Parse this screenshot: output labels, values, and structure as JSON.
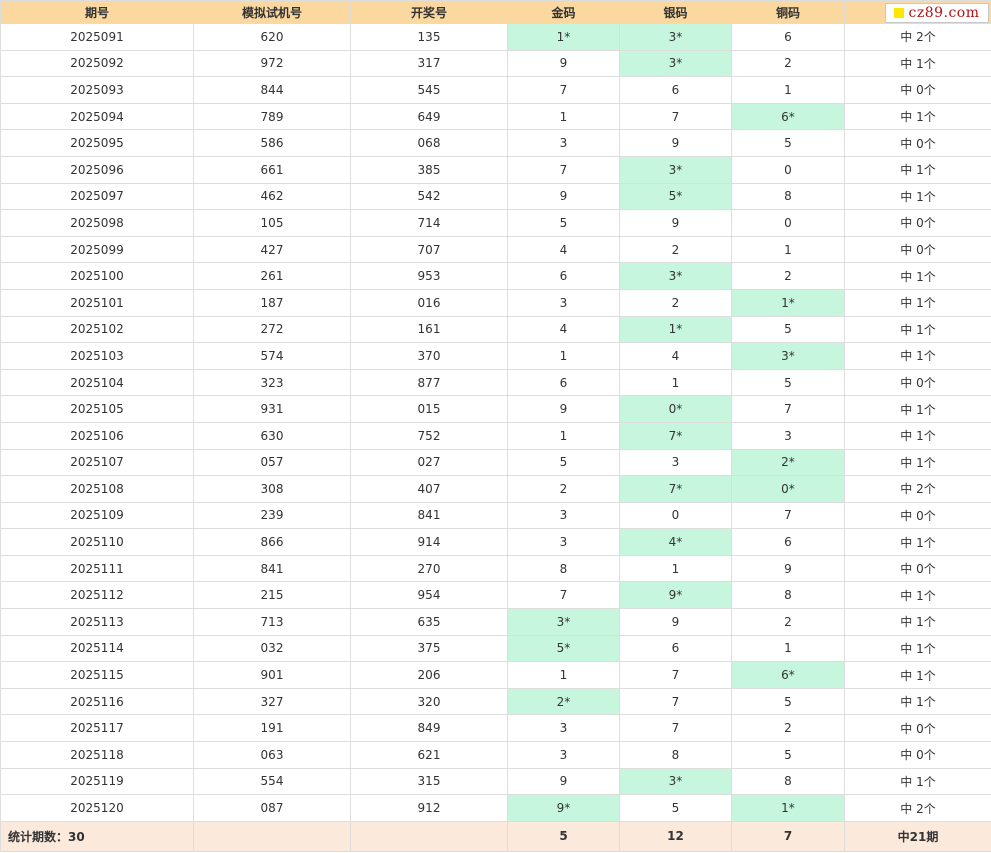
{
  "header": {
    "period": "期号",
    "sim_number": "模拟试机号",
    "draw_number": "开奖号",
    "gold": "金码",
    "silver": "银码",
    "bronze": "铜码",
    "logo_text": "cz89.com"
  },
  "colors": {
    "header_bg": "#fbd89f",
    "hit_bg": "#c6f7de",
    "footer_bg": "#fbe9dc",
    "logo_square": "#ffe600",
    "logo_text": "#b31010"
  },
  "rows": [
    {
      "period": "2025091",
      "sim": "620",
      "draw": "135",
      "gold": {
        "v": "1*",
        "hit": true
      },
      "silver": {
        "v": "3*",
        "hit": true
      },
      "bronze": {
        "v": "6",
        "hit": false
      },
      "result": "中 2个"
    },
    {
      "period": "2025092",
      "sim": "972",
      "draw": "317",
      "gold": {
        "v": "9",
        "hit": false
      },
      "silver": {
        "v": "3*",
        "hit": true
      },
      "bronze": {
        "v": "2",
        "hit": false
      },
      "result": "中 1个"
    },
    {
      "period": "2025093",
      "sim": "844",
      "draw": "545",
      "gold": {
        "v": "7",
        "hit": false
      },
      "silver": {
        "v": "6",
        "hit": false
      },
      "bronze": {
        "v": "1",
        "hit": false
      },
      "result": "中 0个"
    },
    {
      "period": "2025094",
      "sim": "789",
      "draw": "649",
      "gold": {
        "v": "1",
        "hit": false
      },
      "silver": {
        "v": "7",
        "hit": false
      },
      "bronze": {
        "v": "6*",
        "hit": true
      },
      "result": "中 1个"
    },
    {
      "period": "2025095",
      "sim": "586",
      "draw": "068",
      "gold": {
        "v": "3",
        "hit": false
      },
      "silver": {
        "v": "9",
        "hit": false
      },
      "bronze": {
        "v": "5",
        "hit": false
      },
      "result": "中 0个"
    },
    {
      "period": "2025096",
      "sim": "661",
      "draw": "385",
      "gold": {
        "v": "7",
        "hit": false
      },
      "silver": {
        "v": "3*",
        "hit": true
      },
      "bronze": {
        "v": "0",
        "hit": false
      },
      "result": "中 1个"
    },
    {
      "period": "2025097",
      "sim": "462",
      "draw": "542",
      "gold": {
        "v": "9",
        "hit": false
      },
      "silver": {
        "v": "5*",
        "hit": true
      },
      "bronze": {
        "v": "8",
        "hit": false
      },
      "result": "中 1个"
    },
    {
      "period": "2025098",
      "sim": "105",
      "draw": "714",
      "gold": {
        "v": "5",
        "hit": false
      },
      "silver": {
        "v": "9",
        "hit": false
      },
      "bronze": {
        "v": "0",
        "hit": false
      },
      "result": "中 0个"
    },
    {
      "period": "2025099",
      "sim": "427",
      "draw": "707",
      "gold": {
        "v": "4",
        "hit": false
      },
      "silver": {
        "v": "2",
        "hit": false
      },
      "bronze": {
        "v": "1",
        "hit": false
      },
      "result": "中 0个"
    },
    {
      "period": "2025100",
      "sim": "261",
      "draw": "953",
      "gold": {
        "v": "6",
        "hit": false
      },
      "silver": {
        "v": "3*",
        "hit": true
      },
      "bronze": {
        "v": "2",
        "hit": false
      },
      "result": "中 1个"
    },
    {
      "period": "2025101",
      "sim": "187",
      "draw": "016",
      "gold": {
        "v": "3",
        "hit": false
      },
      "silver": {
        "v": "2",
        "hit": false
      },
      "bronze": {
        "v": "1*",
        "hit": true
      },
      "result": "中 1个"
    },
    {
      "period": "2025102",
      "sim": "272",
      "draw": "161",
      "gold": {
        "v": "4",
        "hit": false
      },
      "silver": {
        "v": "1*",
        "hit": true
      },
      "bronze": {
        "v": "5",
        "hit": false
      },
      "result": "中 1个"
    },
    {
      "period": "2025103",
      "sim": "574",
      "draw": "370",
      "gold": {
        "v": "1",
        "hit": false
      },
      "silver": {
        "v": "4",
        "hit": false
      },
      "bronze": {
        "v": "3*",
        "hit": true
      },
      "result": "中 1个"
    },
    {
      "period": "2025104",
      "sim": "323",
      "draw": "877",
      "gold": {
        "v": "6",
        "hit": false
      },
      "silver": {
        "v": "1",
        "hit": false
      },
      "bronze": {
        "v": "5",
        "hit": false
      },
      "result": "中 0个"
    },
    {
      "period": "2025105",
      "sim": "931",
      "draw": "015",
      "gold": {
        "v": "9",
        "hit": false
      },
      "silver": {
        "v": "0*",
        "hit": true
      },
      "bronze": {
        "v": "7",
        "hit": false
      },
      "result": "中 1个"
    },
    {
      "period": "2025106",
      "sim": "630",
      "draw": "752",
      "gold": {
        "v": "1",
        "hit": false
      },
      "silver": {
        "v": "7*",
        "hit": true
      },
      "bronze": {
        "v": "3",
        "hit": false
      },
      "result": "中 1个"
    },
    {
      "period": "2025107",
      "sim": "057",
      "draw": "027",
      "gold": {
        "v": "5",
        "hit": false
      },
      "silver": {
        "v": "3",
        "hit": false
      },
      "bronze": {
        "v": "2*",
        "hit": true
      },
      "result": "中 1个"
    },
    {
      "period": "2025108",
      "sim": "308",
      "draw": "407",
      "gold": {
        "v": "2",
        "hit": false
      },
      "silver": {
        "v": "7*",
        "hit": true
      },
      "bronze": {
        "v": "0*",
        "hit": true
      },
      "result": "中 2个"
    },
    {
      "period": "2025109",
      "sim": "239",
      "draw": "841",
      "gold": {
        "v": "3",
        "hit": false
      },
      "silver": {
        "v": "0",
        "hit": false
      },
      "bronze": {
        "v": "7",
        "hit": false
      },
      "result": "中 0个"
    },
    {
      "period": "2025110",
      "sim": "866",
      "draw": "914",
      "gold": {
        "v": "3",
        "hit": false
      },
      "silver": {
        "v": "4*",
        "hit": true
      },
      "bronze": {
        "v": "6",
        "hit": false
      },
      "result": "中 1个"
    },
    {
      "period": "2025111",
      "sim": "841",
      "draw": "270",
      "gold": {
        "v": "8",
        "hit": false
      },
      "silver": {
        "v": "1",
        "hit": false
      },
      "bronze": {
        "v": "9",
        "hit": false
      },
      "result": "中 0个"
    },
    {
      "period": "2025112",
      "sim": "215",
      "draw": "954",
      "gold": {
        "v": "7",
        "hit": false
      },
      "silver": {
        "v": "9*",
        "hit": true
      },
      "bronze": {
        "v": "8",
        "hit": false
      },
      "result": "中 1个"
    },
    {
      "period": "2025113",
      "sim": "713",
      "draw": "635",
      "gold": {
        "v": "3*",
        "hit": true
      },
      "silver": {
        "v": "9",
        "hit": false
      },
      "bronze": {
        "v": "2",
        "hit": false
      },
      "result": "中 1个"
    },
    {
      "period": "2025114",
      "sim": "032",
      "draw": "375",
      "gold": {
        "v": "5*",
        "hit": true
      },
      "silver": {
        "v": "6",
        "hit": false
      },
      "bronze": {
        "v": "1",
        "hit": false
      },
      "result": "中 1个"
    },
    {
      "period": "2025115",
      "sim": "901",
      "draw": "206",
      "gold": {
        "v": "1",
        "hit": false
      },
      "silver": {
        "v": "7",
        "hit": false
      },
      "bronze": {
        "v": "6*",
        "hit": true
      },
      "result": "中 1个"
    },
    {
      "period": "2025116",
      "sim": "327",
      "draw": "320",
      "gold": {
        "v": "2*",
        "hit": true
      },
      "silver": {
        "v": "7",
        "hit": false
      },
      "bronze": {
        "v": "5",
        "hit": false
      },
      "result": "中 1个"
    },
    {
      "period": "2025117",
      "sim": "191",
      "draw": "849",
      "gold": {
        "v": "3",
        "hit": false
      },
      "silver": {
        "v": "7",
        "hit": false
      },
      "bronze": {
        "v": "2",
        "hit": false
      },
      "result": "中 0个"
    },
    {
      "period": "2025118",
      "sim": "063",
      "draw": "621",
      "gold": {
        "v": "3",
        "hit": false
      },
      "silver": {
        "v": "8",
        "hit": false
      },
      "bronze": {
        "v": "5",
        "hit": false
      },
      "result": "中 0个"
    },
    {
      "period": "2025119",
      "sim": "554",
      "draw": "315",
      "gold": {
        "v": "9",
        "hit": false
      },
      "silver": {
        "v": "3*",
        "hit": true
      },
      "bronze": {
        "v": "8",
        "hit": false
      },
      "result": "中 1个"
    },
    {
      "period": "2025120",
      "sim": "087",
      "draw": "912",
      "gold": {
        "v": "9*",
        "hit": true
      },
      "silver": {
        "v": "5",
        "hit": false
      },
      "bronze": {
        "v": "1*",
        "hit": true
      },
      "result": "中 2个"
    }
  ],
  "footer": {
    "label": "统计期数：30",
    "gold_total": "5",
    "silver_total": "12",
    "bronze_total": "7",
    "result_total": "中21期"
  }
}
